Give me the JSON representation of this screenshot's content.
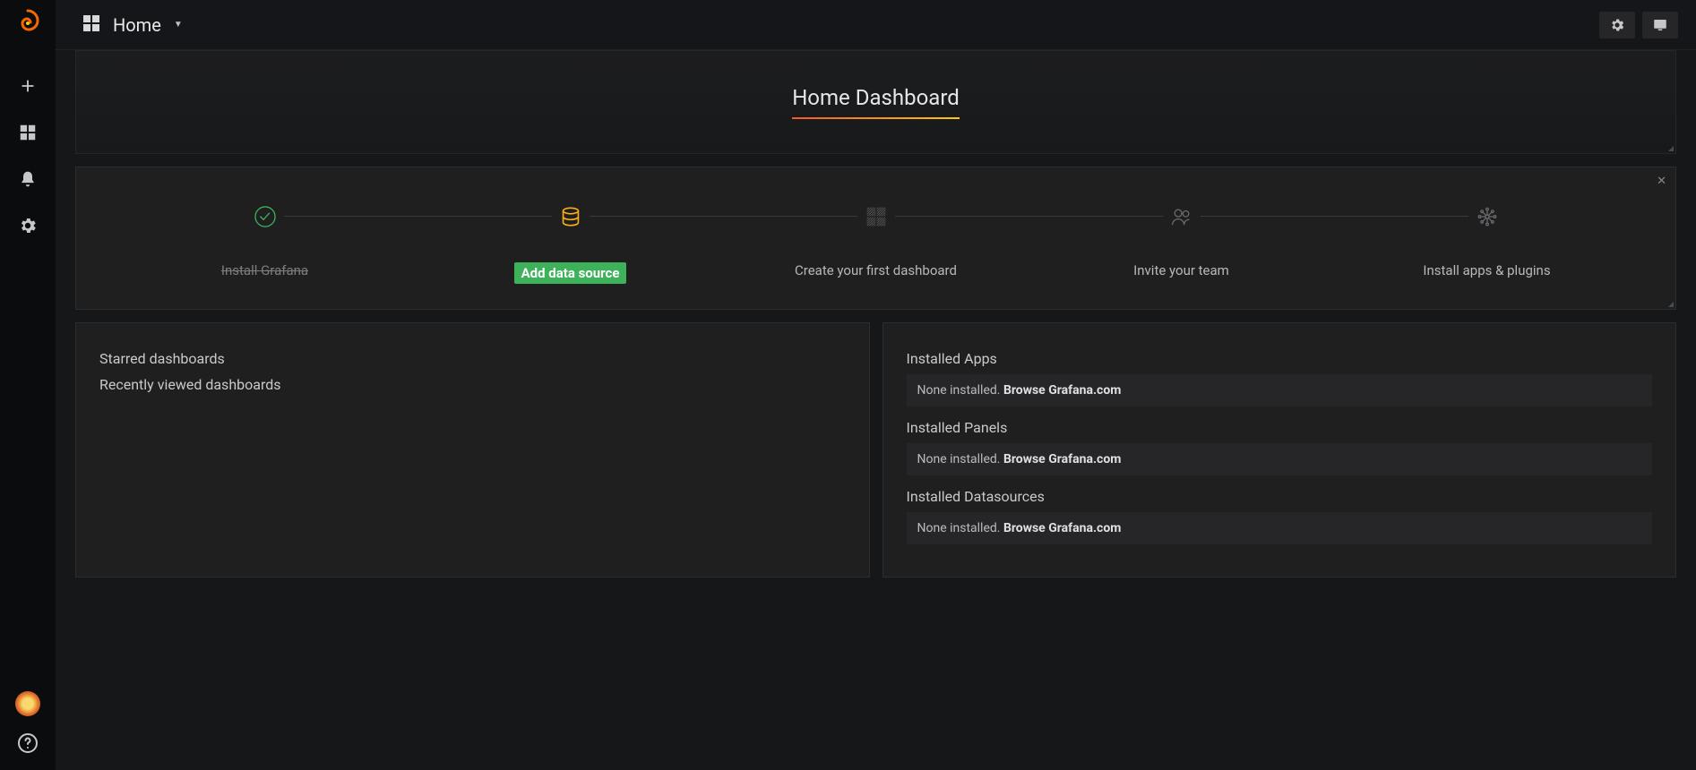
{
  "header": {
    "breadcrumb_label": "Home",
    "page_title": "Home Dashboard"
  },
  "getting_started": {
    "steps": [
      {
        "label": "Install Grafana",
        "state": "done"
      },
      {
        "label": "Add data source",
        "state": "active"
      },
      {
        "label": "Create your first dashboard",
        "state": "todo"
      },
      {
        "label": "Invite your team",
        "state": "todo"
      },
      {
        "label": "Install apps & plugins",
        "state": "todo"
      }
    ]
  },
  "left_panel": {
    "starred_title": "Starred dashboards",
    "recent_title": "Recently viewed dashboards"
  },
  "right_panel": {
    "sections": [
      {
        "title": "Installed Apps",
        "empty_prefix": "None installed. ",
        "link": "Browse Grafana.com"
      },
      {
        "title": "Installed Panels",
        "empty_prefix": "None installed. ",
        "link": "Browse Grafana.com"
      },
      {
        "title": "Installed Datasources",
        "empty_prefix": "None installed. ",
        "link": "Browse Grafana.com"
      }
    ]
  }
}
